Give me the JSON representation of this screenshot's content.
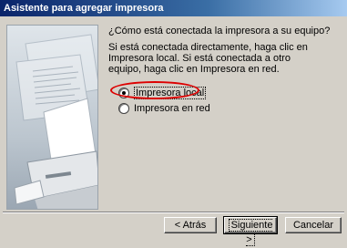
{
  "window": {
    "title": "Asistente para agregar impresora"
  },
  "content": {
    "question": "¿Cómo está conectada la impresora a su equipo?",
    "instructions": "Si está conectada directamente, haga clic en Impresora local. Si está conectada a otro equipo, haga clic en Impresora en red."
  },
  "options": [
    {
      "label": "Impresora local",
      "selected": true
    },
    {
      "label": "Impresora en red",
      "selected": false
    }
  ],
  "buttons": {
    "back": "< Atrás",
    "next": "Siguiente >",
    "cancel": "Cancelar"
  },
  "colors": {
    "titlebar_start": "#0a246a",
    "titlebar_end": "#a6caf0",
    "highlight": "#dd0000"
  }
}
